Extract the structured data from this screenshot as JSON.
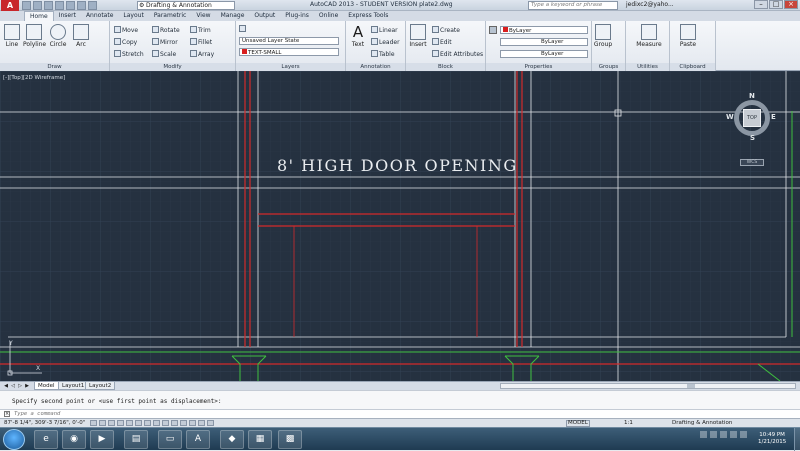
{
  "app": {
    "logo_letter": "A",
    "workspace": "Drafting & Annotation",
    "title": "AutoCAD 2013 - STUDENT VERSION   plate2.dwg",
    "search_placeholder": "Type a keyword or phrase",
    "user": "jedixc2@yaho..."
  },
  "tabs": [
    "Home",
    "Insert",
    "Annotate",
    "Layout",
    "Parametric",
    "View",
    "Manage",
    "Output",
    "Plug-ins",
    "Online",
    "Express Tools"
  ],
  "ribbon": {
    "draw": {
      "title": "Draw",
      "tools": [
        "Line",
        "Polyline",
        "Circle",
        "Arc"
      ]
    },
    "modify": {
      "title": "Modify",
      "tools": [
        "Move",
        "Rotate",
        "Trim",
        "Copy",
        "Mirror",
        "Fillet",
        "Stretch",
        "Scale",
        "Array"
      ]
    },
    "layers": {
      "title": "Layers",
      "layer_state": "Unsaved Layer State",
      "current_layer": "TEXT-SMALL"
    },
    "annotation": {
      "title": "Annotation",
      "text": "Text",
      "linear": "Linear",
      "leader": "Leader",
      "table": "Table"
    },
    "block": {
      "title": "Block",
      "insert": "Insert",
      "create": "Create",
      "edit": "Edit",
      "edit_attributes": "Edit Attributes"
    },
    "properties": {
      "title": "Properties",
      "color": "ByLayer",
      "linetype": "ByLayer",
      "lineweight": "ByLayer"
    },
    "groups": {
      "title": "Groups",
      "group": "Group"
    },
    "utilities": {
      "title": "Utilities",
      "measure": "Measure"
    },
    "clipboard": {
      "title": "Clipboard",
      "paste": "Paste"
    }
  },
  "viewport": {
    "label": "[-][Top][2D Wireframe]",
    "drawing_text": "8' HIGH DOOR OPENING",
    "viewcube": {
      "face": "TOP",
      "n": "N",
      "s": "S",
      "e": "E",
      "w": "W",
      "wcs": "WCS"
    },
    "colors": {
      "background": "#253140",
      "red_line": "#d32b2b",
      "white_line": "#e4e7ea",
      "green_line": "#3fbf3f"
    }
  },
  "layout_tabs": [
    "Model",
    "Layout1",
    "Layout2"
  ],
  "command": {
    "history": "Specify second point or <use first point as displacement>:",
    "placeholder": "Type a command"
  },
  "status": {
    "coords": "87'-8 1/4\",  309'-3 7/16\", 0'-0\"",
    "model": "MODEL",
    "scale": "1:1",
    "workspace": "Drafting & Annotation"
  },
  "taskbar": {
    "time": "10:49 PM",
    "date": "1/21/2015"
  }
}
